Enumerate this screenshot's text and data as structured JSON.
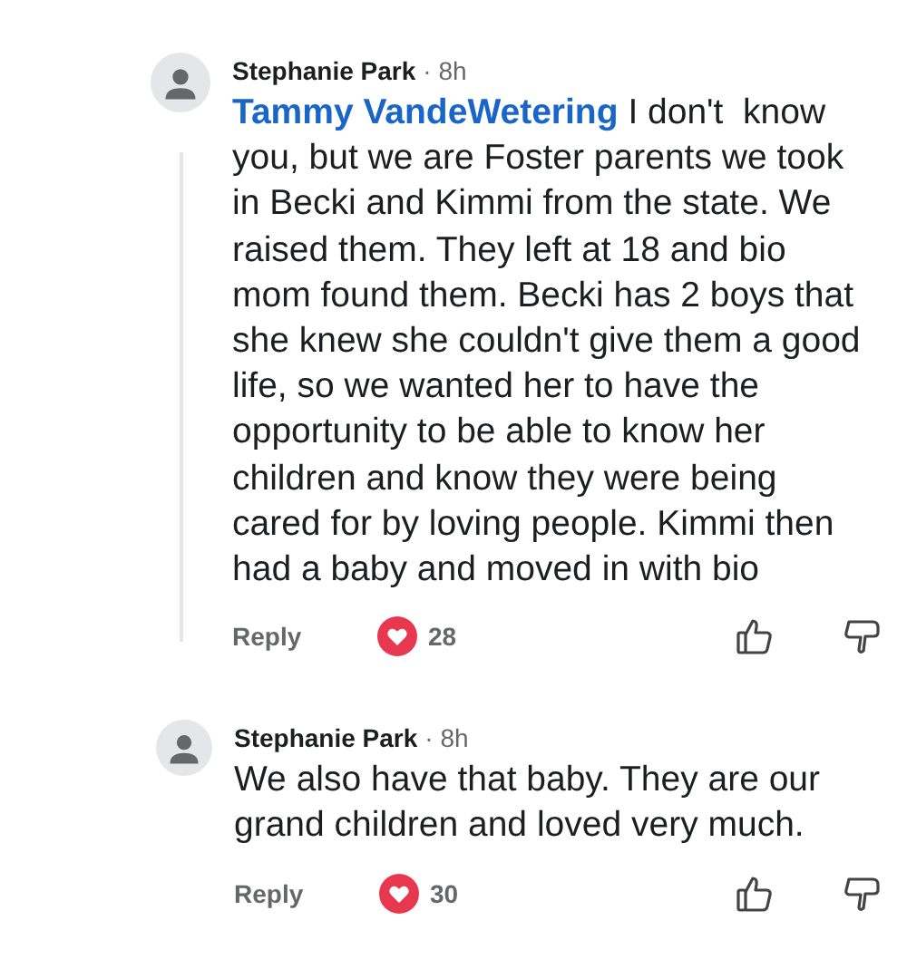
{
  "comments": [
    {
      "author": "Stephanie Park",
      "time": "· 8h",
      "mention": "Tammy VandeWetering",
      "text": "I don't  know you, but we are Foster parents we took in Becki and Kimmi from the state. We raised them. They left at 18 and bio mom found them. Becki has 2 boys that she knew she couldn't give them a good life, so we wanted her to have the opportunity to be able to know her children and know they were being cared for by loving people. Kimmi then had a baby and moved in with bio",
      "reply": "Reply",
      "reactions": "28",
      "children": [
        {
          "author": "Stephanie Park",
          "time": "· 8h",
          "text": "We also have that baby. They are our grand children and loved very much.",
          "reply": "Reply",
          "reactions": "30"
        }
      ]
    }
  ]
}
